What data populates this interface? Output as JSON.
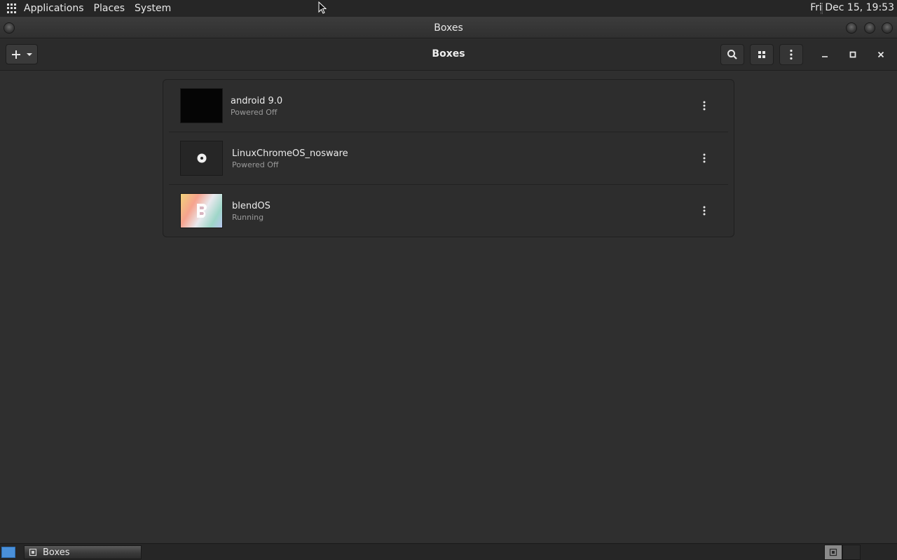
{
  "top_panel": {
    "menus": [
      "Applications",
      "Places",
      "System"
    ],
    "clock": "Fri Dec 15, 19:53"
  },
  "window": {
    "title": "Boxes"
  },
  "header": {
    "title": "Boxes"
  },
  "boxes": [
    {
      "name": "android 9.0",
      "status": "Powered Off"
    },
    {
      "name": "LinuxChromeOS_nosware",
      "status": "Powered Off"
    },
    {
      "name": "blendOS",
      "status": "Running"
    }
  ],
  "taskbar": {
    "task_label": "Boxes"
  },
  "colors": {
    "background": "#2f2f2f",
    "panel": "#262626",
    "accent": "#4a90d9"
  },
  "icons": {
    "apps": "grid-icon",
    "new": "plus-icon",
    "search": "search-icon",
    "view": "grid-view-icon",
    "menu": "vertical-dots-icon",
    "minimize": "minimize-icon",
    "maximize": "maximize-icon",
    "close": "close-icon"
  }
}
